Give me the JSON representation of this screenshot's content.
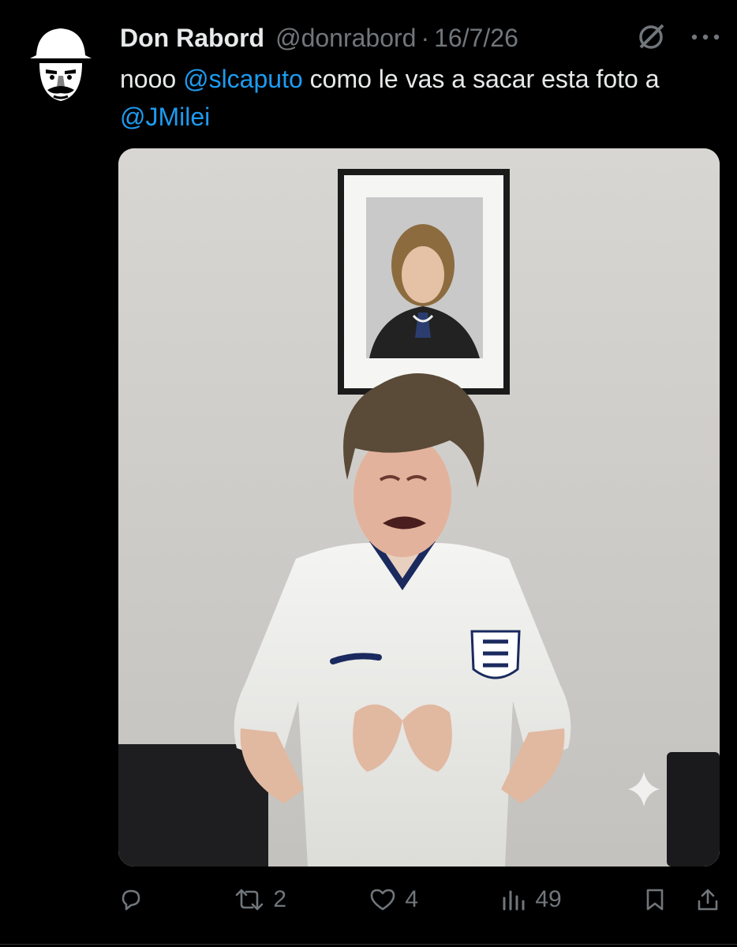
{
  "tweet": {
    "author_name": "Don Rabord",
    "handle": "@donrabord",
    "separator": "·",
    "date": "16/7/26",
    "text_parts": {
      "p1": "nooo ",
      "mention1": "@slcaputo",
      "p2": " como le vas a sacar esta foto a ",
      "mention2": "@JMilei"
    },
    "media": {
      "description_icon": "photo",
      "sparkle_icon": "sparkle-icon"
    }
  },
  "actions": {
    "reply": {
      "icon": "reply-icon",
      "count": ""
    },
    "retweet": {
      "icon": "retweet-icon",
      "count": "2"
    },
    "like": {
      "icon": "heart-icon",
      "count": "4"
    },
    "views": {
      "icon": "views-icon",
      "count": "49"
    },
    "bookmark": {
      "icon": "bookmark-icon"
    },
    "share": {
      "icon": "share-icon"
    }
  },
  "colors": {
    "background": "#000000",
    "text": "#e7e9ea",
    "secondary": "#71767b",
    "link": "#1d9bf0"
  }
}
